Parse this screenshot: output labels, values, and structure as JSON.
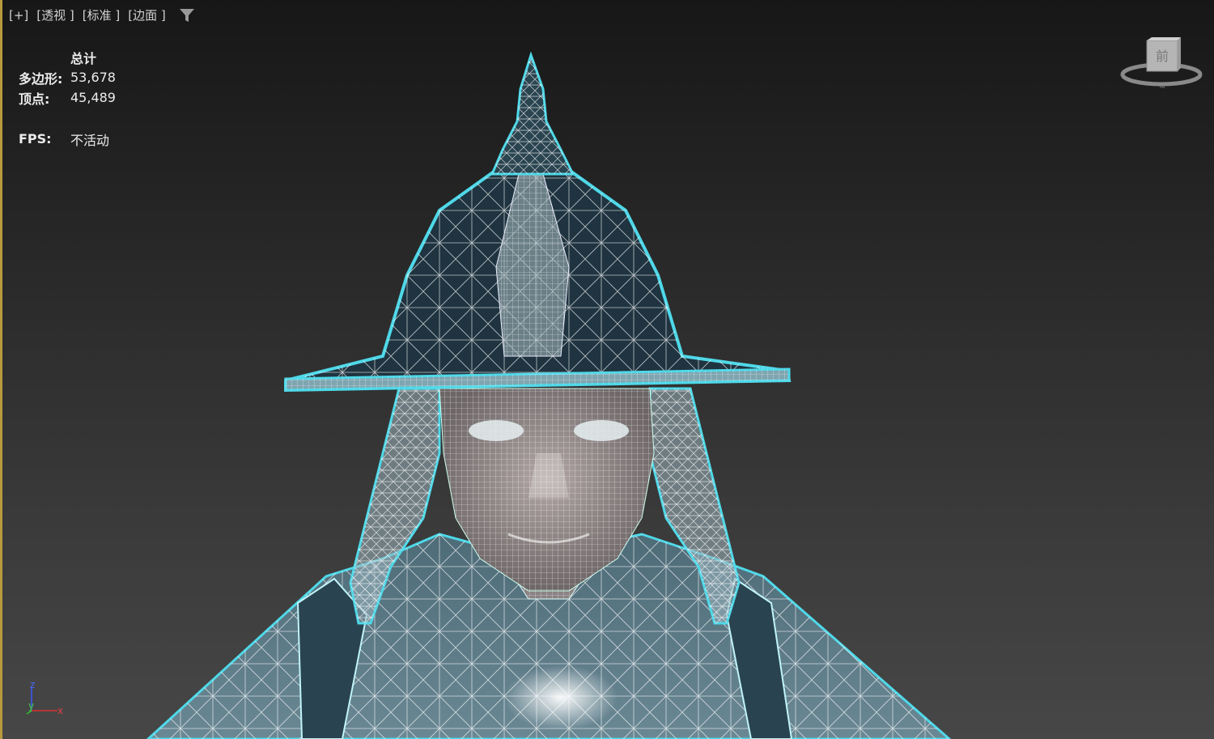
{
  "viewport": {
    "labels": [
      "[+]",
      "[透视 ]",
      "[标准 ]",
      "[边面 ]"
    ],
    "filter_icon": "filter-funnel-icon",
    "border_color": "#b89a3c"
  },
  "stats": {
    "header": "总计",
    "polygons_label": "多边形:",
    "polygons_value": "53,678",
    "vertices_label": "顶点:",
    "vertices_value": "45,489",
    "fps_label": "FPS:",
    "fps_value": "不活动"
  },
  "viewcube": {
    "face_label": "前",
    "compass_label": "南"
  },
  "axis_tripod": {
    "z_label": "z",
    "y_label": "y",
    "x_label": "x"
  },
  "colors": {
    "selection_outline": "#4fd8e8",
    "wireframe": "#ffffff",
    "helmet_fill": "#1f3440",
    "skin_fill": "#8c8586",
    "cloth_fill": "#5b7a88"
  }
}
